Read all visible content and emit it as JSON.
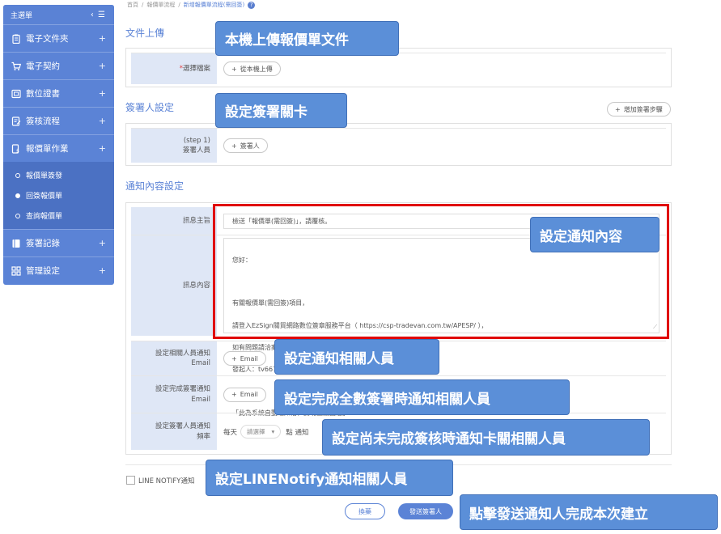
{
  "sidebar": {
    "title": "主選單",
    "toggle": "‹ ☰",
    "items": [
      {
        "label": "電子文件夾",
        "icon": "clipboard-icon"
      },
      {
        "label": "電子契約",
        "icon": "cart-icon"
      },
      {
        "label": "數位證書",
        "icon": "certificate-icon"
      },
      {
        "label": "簽核流程",
        "icon": "approval-icon"
      },
      {
        "label": "報價單作業",
        "icon": "quotation-icon"
      }
    ],
    "sub_items": [
      {
        "label": "報價單簽發",
        "active": false
      },
      {
        "label": "回簽報價單",
        "active": true
      },
      {
        "label": "查詢報價單",
        "active": false
      }
    ],
    "items_after": [
      {
        "label": "簽署記錄",
        "icon": "book-icon"
      },
      {
        "label": "管理設定",
        "icon": "grid-icon"
      }
    ]
  },
  "breadcrumb": [
    "首頁",
    "/",
    "報價單流程",
    "/",
    "新增報價單流程(需回簽)"
  ],
  "upload": {
    "title": "文件上傳",
    "label": "選擇檔案",
    "button": "從本機上傳"
  },
  "signers": {
    "title": "簽署人設定",
    "add_step": "增加簽署步驟",
    "step_label": "(step 1)",
    "signer_label": "簽署人員",
    "add_signer": "簽署人"
  },
  "notify": {
    "title": "通知內容設定",
    "subject_label": "訊息主旨",
    "subject_value": "檢送「報價單(需回簽)」，請覆核。",
    "content_label": "訊息內容",
    "content_lines": [
      "您好：",
      "",
      "有關報價單(需回簽)項目，",
      "請登入EzSign關貿網路數位簽章服務平台（ https://csp-tradevan.com.tw/APESP/ ），",
      "如有問題請洽案件承辦人協助處理，謝謝。",
      "發起人：tv6678(林宛儀)",
      "",
      "「此為系統自動通知信，請勿直接回信」"
    ],
    "related_label_1": "設定相關人員通知",
    "related_label_2": "Email",
    "done_label_1": "設定完成簽署通知",
    "done_label_2": "Email",
    "email_button": "Email",
    "freq_label_1": "設定簽署人員通知",
    "freq_label_2": "頻率",
    "freq_prefix": "每天",
    "freq_select": "請選擇",
    "freq_suffix": "點 通知"
  },
  "line_notify": "LINE NOTIFY通知",
  "actions": {
    "cancel": "換藥",
    "send": "發送簽署人"
  },
  "callouts": {
    "upload": "本機上傳報價單文件",
    "signer": "設定簽署關卡",
    "content": "設定通知內容",
    "related": "設定通知相關人員",
    "done": "設定完成全數簽署時通知相關人員",
    "pending": "設定尚未完成簽核時通知卡關相關人員",
    "line": "設定LINENotify通知相關人員",
    "send": "點擊發送通知人完成本次建立"
  },
  "colors": {
    "sidebar": "#5b83d6",
    "label_bg": "#dfe7f6",
    "callout": "#5b8fd8",
    "highlight": "#e00000"
  }
}
